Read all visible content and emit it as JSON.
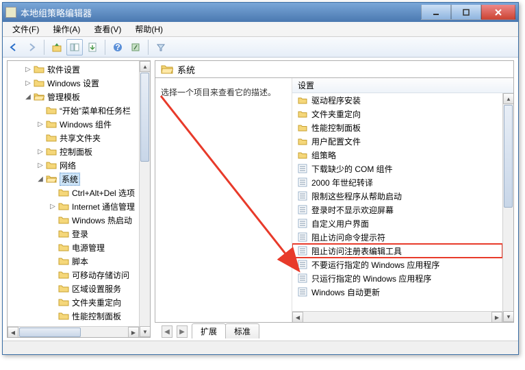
{
  "window": {
    "title": "本地组策略编辑器"
  },
  "menu": {
    "file": "文件(F)",
    "action": "操作(A)",
    "view": "查看(V)",
    "help": "帮助(H)"
  },
  "tree": {
    "items": [
      {
        "depth": 1,
        "exp": "▷",
        "label": "软件设置"
      },
      {
        "depth": 1,
        "exp": "▷",
        "label": "Windows 设置"
      },
      {
        "depth": 1,
        "exp": "◢",
        "label": "管理模板",
        "open": true
      },
      {
        "depth": 2,
        "exp": "",
        "label": "“开始”菜单和任务栏"
      },
      {
        "depth": 2,
        "exp": "▷",
        "label": "Windows 组件"
      },
      {
        "depth": 2,
        "exp": "",
        "label": "共享文件夹"
      },
      {
        "depth": 2,
        "exp": "▷",
        "label": "控制面板"
      },
      {
        "depth": 2,
        "exp": "▷",
        "label": "网络"
      },
      {
        "depth": 2,
        "exp": "◢",
        "label": "系统",
        "open": true,
        "selected": true
      },
      {
        "depth": 3,
        "exp": "",
        "label": "Ctrl+Alt+Del 选项"
      },
      {
        "depth": 3,
        "exp": "▷",
        "label": "Internet 通信管理"
      },
      {
        "depth": 3,
        "exp": "",
        "label": "Windows 热启动"
      },
      {
        "depth": 3,
        "exp": "",
        "label": "登录"
      },
      {
        "depth": 3,
        "exp": "",
        "label": "电源管理"
      },
      {
        "depth": 3,
        "exp": "",
        "label": "脚本"
      },
      {
        "depth": 3,
        "exp": "",
        "label": "可移动存储访问"
      },
      {
        "depth": 3,
        "exp": "",
        "label": "区域设置服务"
      },
      {
        "depth": 3,
        "exp": "",
        "label": "文件夹重定向"
      },
      {
        "depth": 3,
        "exp": "",
        "label": "性能控制面板"
      }
    ]
  },
  "pathbar": {
    "label": "系统"
  },
  "detail": {
    "desc": "选择一个项目来查看它的描述。"
  },
  "listhdr": {
    "col": "设置"
  },
  "rows": [
    {
      "type": "folder",
      "label": "驱动程序安装"
    },
    {
      "type": "folder",
      "label": "文件夹重定向"
    },
    {
      "type": "folder",
      "label": "性能控制面板"
    },
    {
      "type": "folder",
      "label": "用户配置文件"
    },
    {
      "type": "folder",
      "label": "组策略"
    },
    {
      "type": "setting",
      "label": "下载缺少的 COM 组件"
    },
    {
      "type": "setting",
      "label": "2000 年世纪转译"
    },
    {
      "type": "setting",
      "label": "限制这些程序从帮助启动"
    },
    {
      "type": "setting",
      "label": "登录时不显示欢迎屏幕"
    },
    {
      "type": "setting",
      "label": "自定义用户界面"
    },
    {
      "type": "setting",
      "label": "阻止访问命令提示符"
    },
    {
      "type": "setting",
      "label": "阻止访问注册表编辑工具",
      "hl": true
    },
    {
      "type": "setting",
      "label": "不要运行指定的 Windows 应用程序"
    },
    {
      "type": "setting",
      "label": "只运行指定的 Windows 应用程序"
    },
    {
      "type": "setting",
      "label": "Windows 自动更新"
    }
  ],
  "tabs": {
    "extended": "扩展",
    "standard": "标准"
  }
}
